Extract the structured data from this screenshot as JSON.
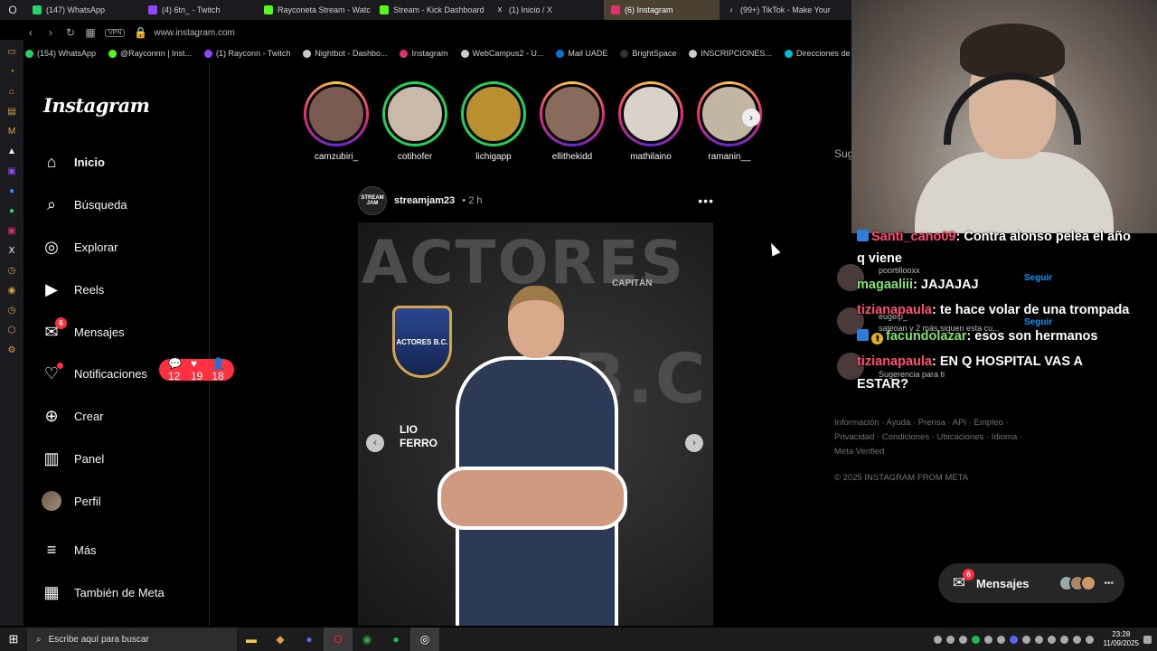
{
  "browser": {
    "tabs": [
      {
        "label": "(147) WhatsApp",
        "color": "#25d366",
        "active": false
      },
      {
        "label": "(4) 6tn_ - Twitch",
        "color": "#9146ff",
        "active": false
      },
      {
        "label": "Rayconeta Stream - Watc",
        "color": "#53fc18",
        "active": false
      },
      {
        "label": "Stream - Kick Dashboard",
        "color": "#53fc18",
        "active": false
      },
      {
        "label": "(1) Inicio / X",
        "color": "#000000",
        "active": false
      },
      {
        "label": "(6) Instagram",
        "color": "#e1306c",
        "active": true
      },
      {
        "label": "(99+) TikTok - Make Your",
        "color": "#111111",
        "active": false
      }
    ],
    "address": {
      "vpn": "VPN",
      "url": "www.instagram.com"
    },
    "bookmarks": [
      {
        "label": "(154) WhatsApp",
        "color": "#25d366"
      },
      {
        "label": "@Rayconnn | Inst...",
        "color": "#53fc18"
      },
      {
        "label": "(1) Rayconn - Twitch",
        "color": "#9146ff"
      },
      {
        "label": "Nightbot - Dashbo...",
        "color": "#cccccc"
      },
      {
        "label": "Instagram",
        "color": "#e1306c"
      },
      {
        "label": "WebCampus2 - U...",
        "color": "#cccccc"
      },
      {
        "label": "Mail UADE",
        "color": "#0078d4"
      },
      {
        "label": "BrightSpace",
        "color": "#333333"
      },
      {
        "label": "INSCRIPCIONES...",
        "color": "#cccccc"
      },
      {
        "label": "Direcciones de co...",
        "color": "#00bcd4"
      }
    ]
  },
  "instagram": {
    "logo": "Instagram",
    "nav": [
      {
        "label": "Inicio",
        "icon": "home-icon",
        "glyph": "⌂"
      },
      {
        "label": "Búsqueda",
        "icon": "search-icon",
        "glyph": "⌕"
      },
      {
        "label": "Explorar",
        "icon": "compass-icon",
        "glyph": "◎"
      },
      {
        "label": "Reels",
        "icon": "reels-icon",
        "glyph": "▶"
      },
      {
        "label": "Mensajes",
        "icon": "messenger-icon",
        "glyph": "✉",
        "badge": "6"
      },
      {
        "label": "Notificaciones",
        "icon": "heart-icon",
        "glyph": "♡"
      },
      {
        "label": "Crear",
        "icon": "plus-icon",
        "glyph": "⊕"
      },
      {
        "label": "Panel",
        "icon": "dashboard-icon",
        "glyph": "▥"
      },
      {
        "label": "Perfil",
        "icon": "avatar",
        "glyph": ""
      },
      {
        "label": "Más",
        "icon": "menu-icon",
        "glyph": "≡"
      },
      {
        "label": "También de Meta",
        "icon": "meta-icon",
        "glyph": "▦"
      }
    ],
    "notif_pill": {
      "comments": "12",
      "likes": "19",
      "follows": "18"
    },
    "stories": [
      {
        "name": "camzubiri_",
        "ring": "gradient"
      },
      {
        "name": "cotihofer",
        "ring": "green"
      },
      {
        "name": "lichigapp",
        "ring": "green"
      },
      {
        "name": "ellithekidd",
        "ring": "gradient"
      },
      {
        "name": "mathilaino",
        "ring": "gradient"
      },
      {
        "name": "ramanin__",
        "ring": "gradient"
      }
    ],
    "post": {
      "avatar_text": "STREAM JAM",
      "username": "streamjam23",
      "time": "• 2 h",
      "more": "•••",
      "image": {
        "big_text_top": "ACTORES",
        "big_text_side": "B.C.",
        "captain": "CAPITÁN",
        "player_first": "LIO",
        "player_last": "FERRO",
        "crest_text": "ACTORES B.C."
      }
    },
    "suggestions_label": "Sug",
    "footer_links": "Información · Ayuda · Prensa · API · Empleo · Privacidad · Condiciones · Ubicaciones · Idioma · Meta Verified",
    "copyright": "© 2025 INSTAGRAM FROM META",
    "messages_float": {
      "label": "Mensajes",
      "badge": "6"
    }
  },
  "chat": {
    "messages": [
      {
        "user": "Santi_cano09",
        "text": ": Contra alonso pelea el año"
      },
      {
        "user": "q viene",
        "text": ""
      },
      {
        "user": "magaaliii",
        "text": ": JAJAJAJ"
      },
      {
        "user": "tizianapaula",
        "text": ": te hace volar de una trompada"
      },
      {
        "user": "facundolazar",
        "text": ": esos son hermanos"
      },
      {
        "user": "tizianapaula",
        "text": ": EN Q HOSPITAL VAS A"
      },
      {
        "user": "ESTAR?",
        "text": ""
      }
    ],
    "ghosts": {
      "g1": "poortillooxx",
      "g2": "eugelp_",
      "g3": "Sugerencia para ti",
      "g4": "saleoan y 2 más siguen esta cu...",
      "seguir": "Seguir"
    }
  },
  "taskbar": {
    "search_placeholder": "Escribe aquí para buscar",
    "time": "23:28",
    "date": "11/09/2025"
  }
}
